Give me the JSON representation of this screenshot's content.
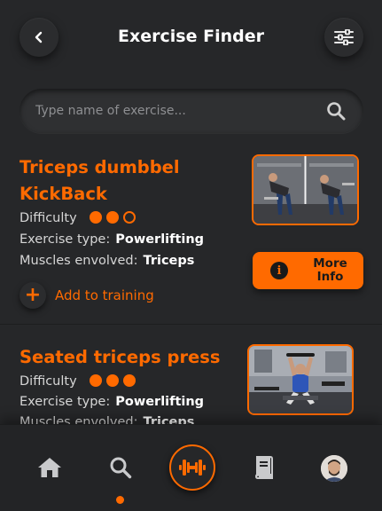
{
  "header": {
    "title": "Exercise Finder",
    "back_icon": "chevron-left-icon",
    "filter_icon": "sliders-icon"
  },
  "search": {
    "placeholder": "Type name of exercise...",
    "value": "",
    "icon": "search-icon"
  },
  "exercises": [
    {
      "title_line1": "Triceps dumbbel",
      "title_line2": "KickBack",
      "difficulty_label": "Difficulty",
      "difficulty_level": 2,
      "difficulty_max": 3,
      "type_label": "Exercise type:",
      "type_value": "Powerlifting",
      "muscles_label": "Muscles envolved:",
      "muscles_value": "Triceps",
      "add_label": "Add to training",
      "more_label_line1": "More",
      "more_label_line2": "Info"
    },
    {
      "title_line1": "Seated triceps press",
      "difficulty_label": "Difficulty",
      "difficulty_level": 3,
      "difficulty_max": 3,
      "type_label": "Exercise type:",
      "type_value": "Powerlifting",
      "muscles_label": "Muscles envolved:",
      "muscles_value": "Triceps"
    }
  ],
  "nav": {
    "items": [
      "home-icon",
      "search-icon",
      "dumbbell-icon",
      "book-icon",
      "avatar"
    ],
    "active": "search"
  },
  "colors": {
    "accent": "#ff6a00",
    "background": "#262729"
  }
}
